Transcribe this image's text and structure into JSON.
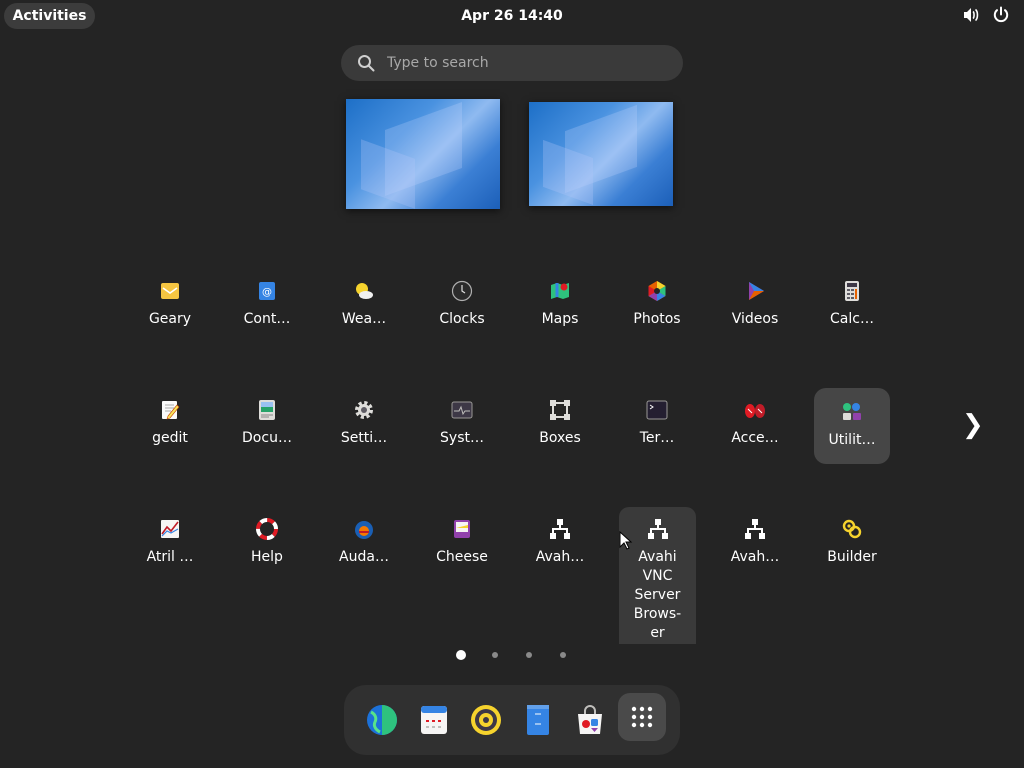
{
  "topbar": {
    "activities_label": "Activities",
    "clock": "Apr 26  14:40",
    "tray_icons": [
      "volume-icon",
      "power-icon"
    ]
  },
  "search": {
    "placeholder": "Type to search",
    "value": ""
  },
  "workspaces": [
    {
      "name": "workspace-1"
    },
    {
      "name": "workspace-2"
    }
  ],
  "app_grid": {
    "rows": [
      [
        {
          "label": "Geary",
          "icon": "geary-icon",
          "color": "#f5c542"
        },
        {
          "label": "Cont…",
          "icon": "contacts-icon",
          "color": "#3584e4"
        },
        {
          "label": "Wea…",
          "icon": "weather-icon",
          "color": "#f6d32d"
        },
        {
          "label": "Clocks",
          "icon": "clocks-icon",
          "color": "#3d3d3d"
        },
        {
          "label": "Maps",
          "icon": "maps-icon",
          "color": "#e01b24"
        },
        {
          "label": "Photos",
          "icon": "photos-icon",
          "color": "#e66100"
        },
        {
          "label": "Videos",
          "icon": "videos-icon",
          "color": "#9141ac"
        },
        {
          "label": "Calc…",
          "icon": "calculator-icon",
          "color": "#deddda"
        }
      ],
      [
        {
          "label": "gedit",
          "icon": "gedit-icon",
          "color": "#f8e45c"
        },
        {
          "label": "Docu…",
          "icon": "document-viewer-icon",
          "color": "#26a269"
        },
        {
          "label": "Setti…",
          "icon": "settings-icon",
          "color": "#deddda"
        },
        {
          "label": "Syst…",
          "icon": "system-monitor-icon",
          "color": "#5e5c64"
        },
        {
          "label": "Boxes",
          "icon": "boxes-icon",
          "color": "#deddda"
        },
        {
          "label": "Ter…",
          "icon": "terminal-icon",
          "color": "#3d3846"
        },
        {
          "label": "Acce…",
          "icon": "accessories-icon",
          "color": "#e01b24"
        },
        {
          "label": "Utilit…",
          "icon": "utilities-folder-icon",
          "color": "#3584e4"
        }
      ],
      [
        {
          "label": "Atril …",
          "icon": "atril-icon",
          "color": "#c01c28"
        },
        {
          "label": "Help",
          "icon": "help-icon",
          "color": "#e01b24"
        },
        {
          "label": "Auda…",
          "icon": "audacity-icon",
          "color": "#1a5fb4"
        },
        {
          "label": "Cheese",
          "icon": "cheese-icon",
          "color": "#9141ac"
        },
        {
          "label": "Avah…",
          "icon": "avahi-ssh-icon",
          "color": "#ffffff"
        },
        {
          "label": "Avahi VNC Server Brows-er",
          "icon": "avahi-vnc-icon",
          "color": "#ffffff"
        },
        {
          "label": "Avah…",
          "icon": "avahi-zeroconf-icon",
          "color": "#ffffff"
        },
        {
          "label": "Builder",
          "icon": "builder-icon",
          "color": "#f6d32d"
        }
      ]
    ]
  },
  "pager": {
    "pages": 4,
    "current": 1,
    "next_icon": "chevron-right-icon"
  },
  "dock": {
    "items": [
      {
        "name": "web-browser",
        "icon": "web-browser-icon"
      },
      {
        "name": "calendar",
        "icon": "calendar-icon"
      },
      {
        "name": "rhythmbox",
        "icon": "rhythmbox-icon"
      },
      {
        "name": "files",
        "icon": "files-icon"
      },
      {
        "name": "software",
        "icon": "software-icon"
      },
      {
        "name": "show-apps",
        "icon": "app-grid-icon"
      }
    ]
  }
}
